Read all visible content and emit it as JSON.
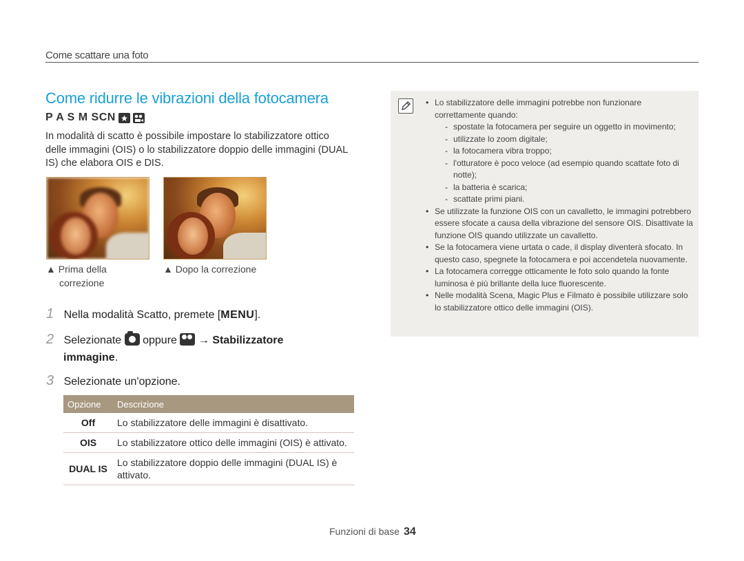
{
  "header": {
    "section": "Come scattare una foto"
  },
  "title": "Come ridurre le vibrazioni della fotocamera",
  "modes": {
    "text": "P A S M SCN",
    "icons": [
      "smart-mode-icon",
      "movie-mode-icon"
    ]
  },
  "intro": "In modalità di scatto è possibile impostare lo stabilizzatore ottico delle immagini (OIS) o lo stabilizzatore doppio delle immagini (DUAL IS) che elabora OIS e DIS.",
  "captions": {
    "before_line1": "▲ Prima della",
    "before_line2": "correzione",
    "after": "▲ Dopo la correzione"
  },
  "steps": [
    {
      "num": "1",
      "pre": "Nella modalità Scatto, premete [",
      "key": "MENU",
      "post": "]."
    },
    {
      "num": "2",
      "pre": "Selezionate",
      "mid": "oppure",
      "arrow": "→ Stabilizzatore",
      "line2": "immagine",
      "post": "."
    },
    {
      "num": "3",
      "text": "Selezionate un'opzione."
    }
  ],
  "table": {
    "headers": [
      "Opzione",
      "Descrizione"
    ],
    "rows": [
      {
        "key": "Off",
        "desc": "Lo stabilizzatore delle immagini è disattivato."
      },
      {
        "key": "OIS",
        "desc": "Lo stabilizzatore ottico delle immagini (OIS) è attivato."
      },
      {
        "key": "DUAL IS",
        "desc": "Lo stabilizzatore doppio delle immagini (DUAL IS) è attivato."
      }
    ]
  },
  "notes": {
    "n1": "Lo stabilizzatore delle immagini potrebbe non funzionare correttamente quando:",
    "sub": [
      "spostate la fotocamera per seguire un oggetto in movimento;",
      "utilizzate lo zoom digitale;",
      "la fotocamera vibra troppo;",
      "l'otturatore è poco veloce (ad esempio quando scattate foto di notte);",
      "la batteria è scarica;",
      "scattate primi piani."
    ],
    "n2": "Se utilizzate la funzione OIS con un cavalletto, le immagini potrebbero essere sfocate a causa della vibrazione del sensore OIS. Disattivate la funzione OIS quando utilizzate un cavalletto.",
    "n3": "Se la fotocamera viene urtata o cade, il display diventerà sfocato. In questo caso, spegnete la fotocamera e poi accendetela nuovamente.",
    "n4": "La fotocamera corregge otticamente le foto solo quando la fonte luminosa è più brillante della luce fluorescente.",
    "n5": "Nelle modalità Scena, Magic Plus e Filmato è possibile utilizzare solo lo stabilizzatore ottico delle immagini (OIS)."
  },
  "footer": {
    "label": "Funzioni di base",
    "page": "34"
  }
}
